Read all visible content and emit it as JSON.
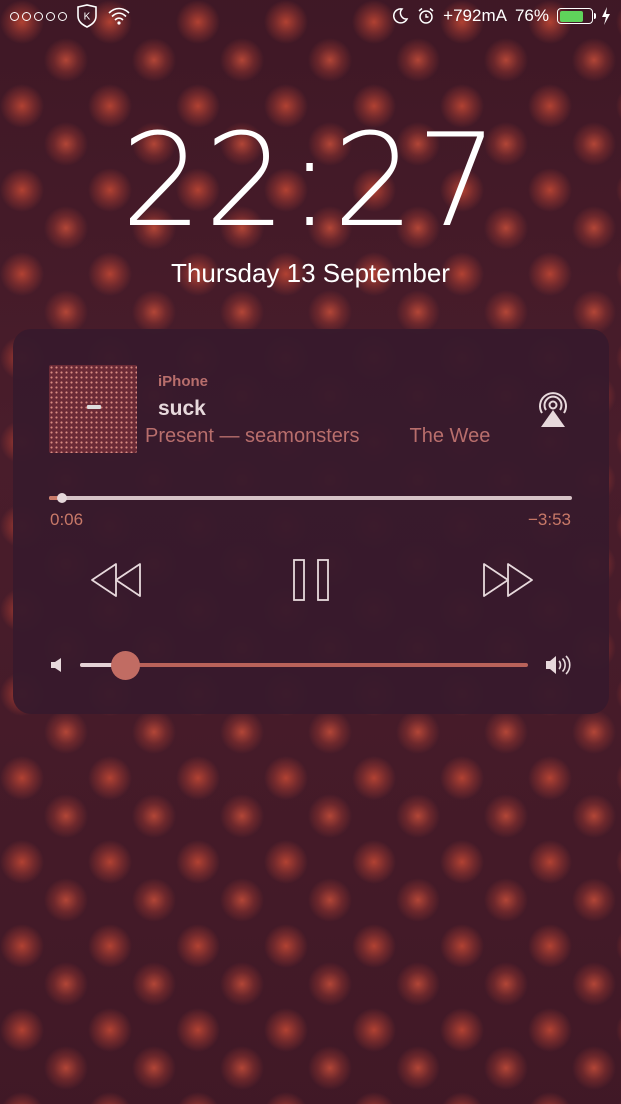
{
  "status_bar": {
    "carrier_badge": "K",
    "charge_rate": "+792mA",
    "battery_percent": "76%",
    "battery_level": 0.76,
    "icons": [
      "signal-dots-icon",
      "carrier-shield-icon",
      "wifi-icon",
      "moon-icon",
      "alarm-icon",
      "battery-icon",
      "charging-bolt-icon"
    ]
  },
  "lock_screen": {
    "time": "22:27",
    "date": "Thursday 13 September"
  },
  "now_playing": {
    "source": "iPhone",
    "track": "suck",
    "subtitle": "Present — seamonsters",
    "subtitle_next": "The Wee",
    "elapsed": "0:06",
    "remaining": "−3:53",
    "progress": 0.025,
    "volume": 0.1,
    "colors": {
      "accent": "#c87968",
      "card_bg": "#381a2c",
      "track_text": "#e7d9dc"
    },
    "icons": [
      "airplay-icon",
      "rewind-icon",
      "pause-icon",
      "fast-forward-icon",
      "volume-low-icon",
      "volume-high-icon"
    ]
  }
}
